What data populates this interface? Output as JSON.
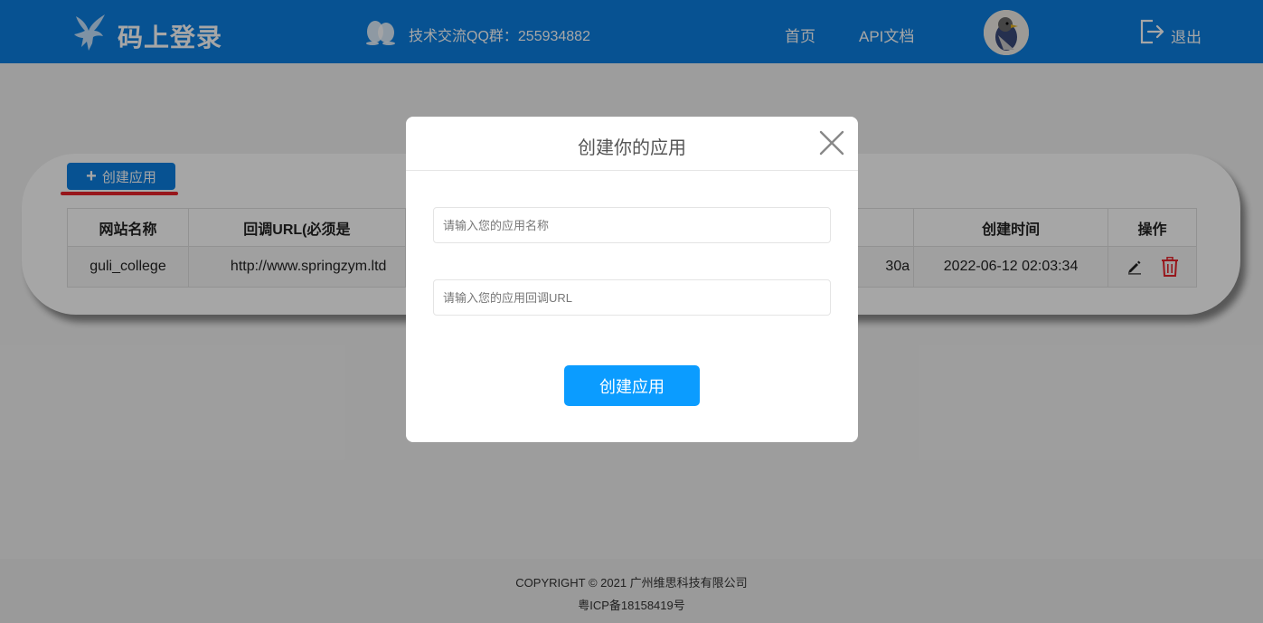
{
  "header": {
    "logo_text": "码上登录",
    "qq_text": "技术交流QQ群：255934882",
    "nav_home": "首页",
    "nav_api": "API文档",
    "user_name": "",
    "logout_label": "退出"
  },
  "toolbar": {
    "create_label": "创建应用"
  },
  "table": {
    "columns": [
      "网站名称",
      "回调URL(必须是",
      "",
      "创建时间",
      "操作"
    ],
    "rows": [
      {
        "name": "guli_college",
        "callback": "http://www.springzym.ltd",
        "secret_tail": "30a",
        "created": "2022-06-12 02:03:34"
      }
    ]
  },
  "modal": {
    "title": "创建你的应用",
    "name_placeholder": "请输入您的应用名称",
    "url_placeholder": "请输入您的应用回调URL",
    "submit_label": "创建应用"
  },
  "footer": {
    "copyright": "COPYRIGHT © 2021 广州维思科技有限公司",
    "icp": "粤ICP备18158419号"
  },
  "colors": {
    "primary": "#0b7ee0",
    "submit": "#0b9cff",
    "danger": "#e8232a"
  },
  "icons": [
    "pegasus-logo-icon",
    "qq-icon",
    "logout-icon",
    "edit-icon",
    "trash-icon",
    "close-icon",
    "plus-icon"
  ]
}
